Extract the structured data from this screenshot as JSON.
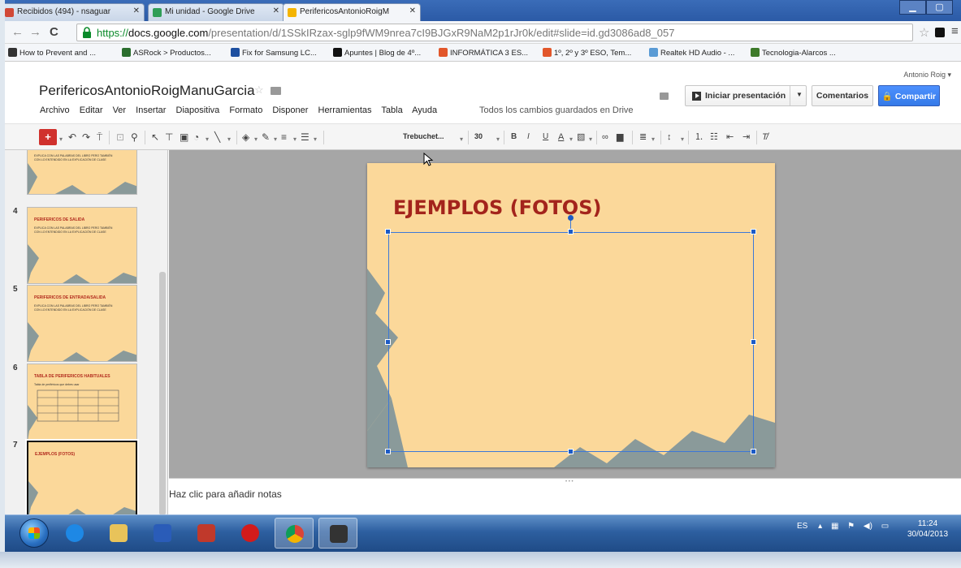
{
  "browser": {
    "tabs": [
      {
        "label": "Recibidos (494) - nsaguar",
        "color": "#d14836"
      },
      {
        "label": "Mi unidad - Google Drive",
        "color": "#2f9e57"
      },
      {
        "label": "PerifericosAntonioRoigM",
        "color": "#f4b400"
      }
    ],
    "url": {
      "scheme": "https://",
      "host": "docs.google.com",
      "path": "/presentation/d/1SSkIRzax-sglp9fWM9nrea7cI9BJGxR9NaM2p1rJr0k/edit#slide=id.gd3086ad8_057"
    },
    "bookmarks": [
      {
        "label": "How to Prevent and ...",
        "color": "#333333"
      },
      {
        "label": "ASRock > Productos...",
        "color": "#2b6e2e"
      },
      {
        "label": "Fix for Samsung LC...",
        "color": "#1d4fa0"
      },
      {
        "label": "Apuntes | Blog de 4º...",
        "color": "#111111"
      },
      {
        "label": "INFORMÁTICA 3 ES...",
        "color": "#e2572b"
      },
      {
        "label": "1º, 2º y 3º ESO, Tem...",
        "color": "#e2572b"
      },
      {
        "label": "Realtek HD Audio - ...",
        "color": "#5a9bd5"
      },
      {
        "label": "Tecnologia-Alarcos ...",
        "color": "#3d7a2a"
      }
    ]
  },
  "docs": {
    "title": "PerifericosAntonioRoigManuGarcia",
    "user": "Antonio Roig",
    "menu": [
      "Archivo",
      "Editar",
      "Ver",
      "Insertar",
      "Diapositiva",
      "Formato",
      "Disponer",
      "Herramientas",
      "Tabla",
      "Ayuda"
    ],
    "saved_status": "Todos los cambios guardados en Drive",
    "present_label": "Iniciar presentación",
    "comments_label": "Comentarios",
    "share_label": "Compartir"
  },
  "toolbar": {
    "font": "Trebuchet...",
    "size": "30"
  },
  "filmstrip": {
    "slides": [
      {
        "num": "",
        "title": "",
        "body": "EXPLICA CON LAS PALABRAS DEL LIBRO PERO TAMBIÉN CON LO ENTENDIDO EN LA EXPLICACIÓN DE CLASE"
      },
      {
        "num": "4",
        "title": "PERIFERICOS DE SALIDA",
        "body": "EXPLICA CON LAS PALABRAS DEL LIBRO PERO TAMBIÉN CON LO ENTENDIDO EN LA EXPLICACIÓN DE CLASE"
      },
      {
        "num": "5",
        "title": "PERIFERICOS DE ENTRADA/SALIDA",
        "body": "EXPLICA CON LAS PALABRAS DEL LIBRO PERO TAMBIÉN CON LO ENTENDIDO EN LA EXPLICACIÓN DE CLASE"
      },
      {
        "num": "6",
        "title": "TABLA DE PERIFERICOS HABITUALES",
        "body": "Tabla de periféricos que debes usar"
      },
      {
        "num": "7",
        "title": "EJEMPLOS (FOTOS)",
        "body": ""
      }
    ]
  },
  "slide": {
    "title": "EJEMPLOS (FOTOS)",
    "bg": "#fbd89a",
    "title_color": "#a3241c",
    "shape_color": "#8a9a9a"
  },
  "notes": {
    "placeholder": "Haz clic para añadir notas"
  },
  "taskbar": {
    "lang": "ES",
    "time": "11:24",
    "date": "30/04/2013"
  }
}
